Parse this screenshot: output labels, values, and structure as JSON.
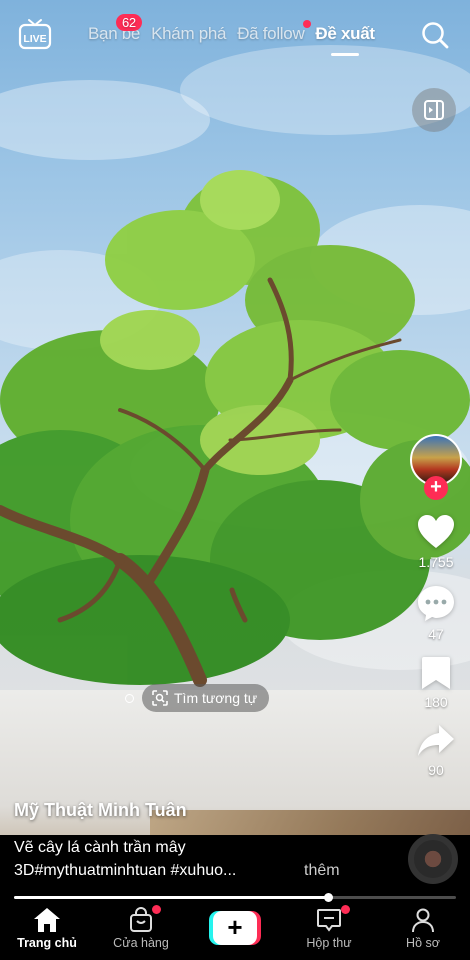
{
  "top_nav": {
    "live_label": "LIVE",
    "tabs": [
      {
        "label": "Bạn bè",
        "badge": "62"
      },
      {
        "label": "Khám phá"
      },
      {
        "label": "Đã follow",
        "has_dot": true
      },
      {
        "label": "Đề xuất",
        "active": true
      }
    ],
    "search_icon": "search-icon"
  },
  "pip_icon": "picture-in-picture-icon",
  "actions": {
    "follow_symbol": "+",
    "like_count": "1.755",
    "comment_count": "47",
    "save_count": "180",
    "share_count": "90"
  },
  "similar": {
    "label": "Tìm tương tự"
  },
  "post": {
    "author": "Mỹ Thuật Minh Tuân",
    "caption_line1": "Vẽ cây lá cành trần mây",
    "caption_line2": "3D#mythuatminhtuan #xuhuo...",
    "more_label": "thêm"
  },
  "playback": {
    "progress": 0.71
  },
  "bottom_nav": {
    "items": [
      {
        "label": "Trang chủ",
        "icon": "home-icon",
        "active": true
      },
      {
        "label": "Cửa hàng",
        "icon": "shop-bag-icon",
        "has_dot": true
      },
      {
        "label": "",
        "icon": "create-plus-icon",
        "symbol": "+"
      },
      {
        "label": "Hộp thư",
        "icon": "inbox-icon",
        "has_dot": true
      },
      {
        "label": "Hồ sơ",
        "icon": "profile-icon"
      }
    ]
  },
  "colors": {
    "accent": "#fe2c55",
    "cyan": "#25f4ee",
    "background": "#000000"
  }
}
